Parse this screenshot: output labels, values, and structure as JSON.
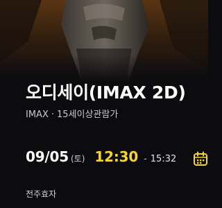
{
  "movie": {
    "title": "오디세이(IMAX 2D)",
    "format": "IMAX",
    "dot": "·",
    "rating": "15세이상관람가"
  },
  "showtime": {
    "date": "09/05",
    "weekday": "(토)",
    "start_time": "12:30",
    "separator": "-",
    "end_time": "15:32"
  },
  "theater": {
    "name": "전주효자"
  },
  "icons": {
    "calendar": "calendar-icon"
  },
  "colors": {
    "background": "#0c0c0e",
    "start_time": "#f5d532",
    "calendar_icon": "#f5d532"
  }
}
